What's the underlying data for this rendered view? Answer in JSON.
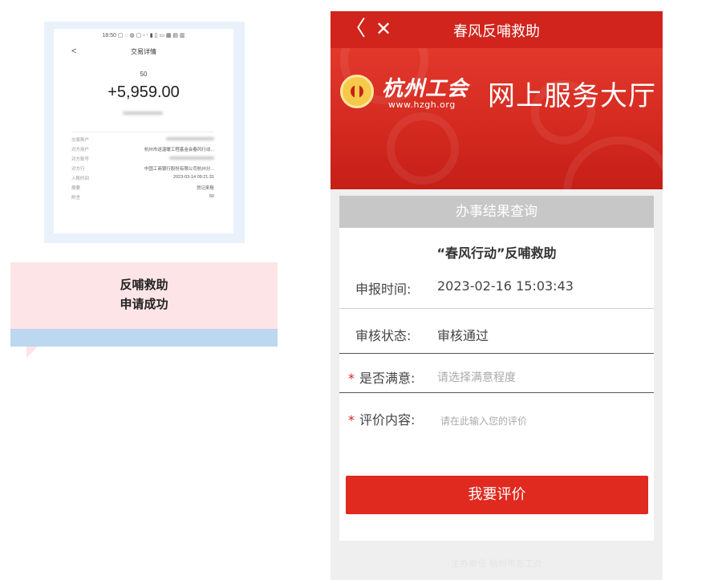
{
  "transaction_screenshot": {
    "status_bar": "18:50 ▢ ◌ ◍ ▢ ▫ ⋅ ▮ ▯ ▭ ▦ ▤ ▥",
    "back_glyph": "<",
    "title": "交易详情",
    "subtitle": "50",
    "amount": "+5,959.00",
    "rows": [
      {
        "label": "交易账户",
        "value": ""
      },
      {
        "label": "对方用户",
        "value": "杭州市送温暖工程基金会春风行动..."
      },
      {
        "label": "对方账号",
        "value": ""
      },
      {
        "label": "对方行",
        "value": "中国工商银行股份有限公司杭州分..."
      },
      {
        "label": "入账时间",
        "value": "2023-03-14 09:21:31"
      },
      {
        "label": "摘要",
        "value": "贷记来账"
      },
      {
        "label": "附言",
        "value": "50"
      }
    ]
  },
  "note": {
    "line1": "反哺救助",
    "line2": "申请成功"
  },
  "app": {
    "nav": {
      "back_glyph": "〈",
      "close_glyph": "✕",
      "title": "春风反哺救助"
    },
    "banner": {
      "brand": "杭州工会",
      "url": "www.hzgh.org",
      "hall": "网上服务大厅"
    },
    "card": {
      "header": "办事结果查询",
      "subject": "“春风行动”反哺救助",
      "apply_time_label": "申报时间:",
      "apply_time_value": "2023-02-16 15:03:43",
      "review_label": "审核状态:",
      "review_value": "审核通过",
      "satisfaction_star": "*",
      "satisfaction_label": "是否满意:",
      "satisfaction_placeholder": "请选择满意程度",
      "comment_star": "*",
      "comment_label": "评价内容:",
      "comment_placeholder": "请在此输入您的评价",
      "submit_label": "我要评价"
    },
    "footer": "主办单位  杭州市总工会"
  },
  "colors": {
    "nav_red": "#d0241c",
    "button_red": "#e0291f",
    "header_gray": "#c7c7c7",
    "note_pink": "#fde4e6",
    "note_blue": "#bcd7f0"
  }
}
